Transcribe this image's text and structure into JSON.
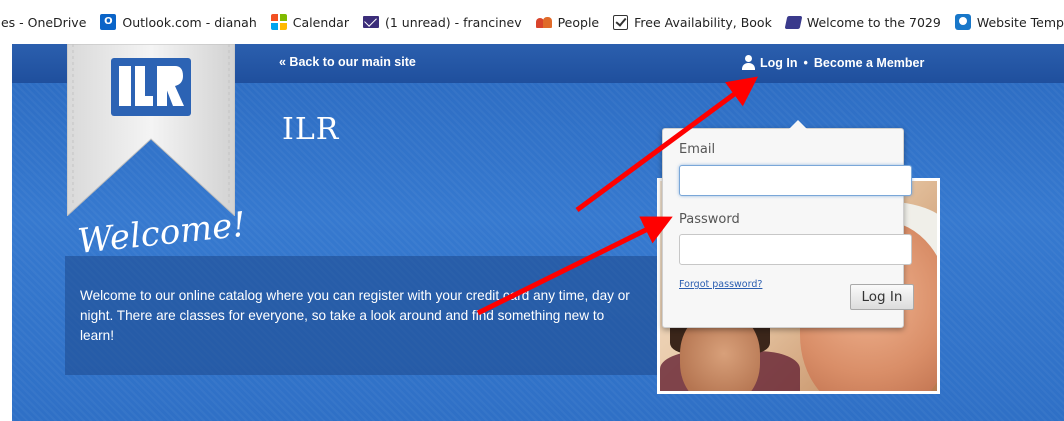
{
  "bookmarks": [
    {
      "label": "iles - OneDrive",
      "icon": "none"
    },
    {
      "label": "Outlook.com - dianah",
      "icon": "outlook-icon"
    },
    {
      "label": "Calendar",
      "icon": "microsoft-icon"
    },
    {
      "label": "(1 unread) - francinev",
      "icon": "mail-icon"
    },
    {
      "label": "People",
      "icon": "people-icon"
    },
    {
      "label": "Free Availability, Book",
      "icon": "checkbox-icon"
    },
    {
      "label": "Welcome to the 7029",
      "icon": "book-icon"
    },
    {
      "label": "Website Template",
      "icon": "site-icon"
    }
  ],
  "site": {
    "logo_text": "ILR",
    "back_link": "« Back to our main site",
    "title": "ILR",
    "account": {
      "login": "Log In",
      "separator": "•",
      "become_member": "Become a Member"
    },
    "welcome_heading": "Welcome!",
    "welcome_text": "Welcome to our online catalog where you can register with your credit card any time, day or night. There are classes for everyone, so take a look around and find something new to learn!"
  },
  "login_popup": {
    "email_label": "Email",
    "email_value": "",
    "password_label": "Password",
    "password_value": "",
    "forgot_password": "Forgot password?",
    "button": "Log In"
  },
  "colors": {
    "hero_blue": "#3679cf",
    "topbar_blue": "#1f4f9d",
    "annotation_red": "#ff0000"
  }
}
